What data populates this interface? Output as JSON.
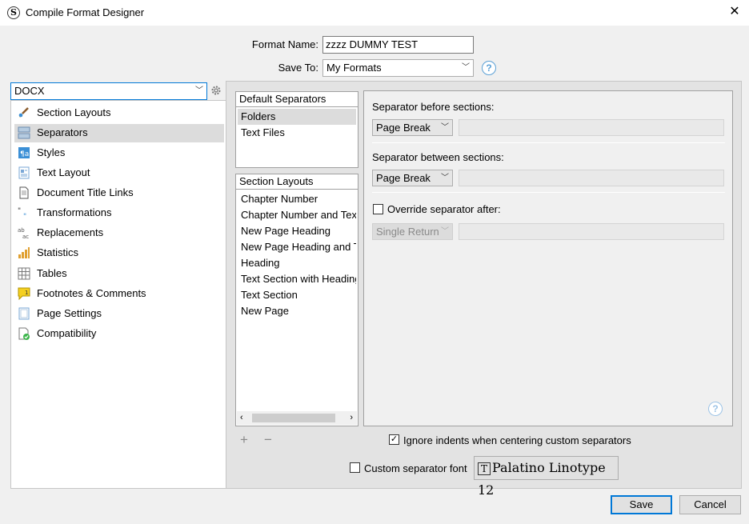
{
  "window": {
    "title": "Compile Format Designer",
    "app_icon": "S",
    "close_glyph": "✕"
  },
  "header": {
    "format_name_label": "Format Name:",
    "format_name_value": "zzzz DUMMY TEST",
    "save_to_label": "Save To:",
    "save_to_value": "My Formats"
  },
  "format_select": {
    "value": "DOCX"
  },
  "sidebar": {
    "items": [
      {
        "label": "Section Layouts",
        "icon": "brush-icon"
      },
      {
        "label": "Separators",
        "icon": "separator-icon"
      },
      {
        "label": "Styles",
        "icon": "styles-icon"
      },
      {
        "label": "Text Layout",
        "icon": "text-layout-icon"
      },
      {
        "label": "Document Title Links",
        "icon": "document-icon"
      },
      {
        "label": "Transformations",
        "icon": "quotes-icon"
      },
      {
        "label": "Replacements",
        "icon": "replace-icon"
      },
      {
        "label": "Statistics",
        "icon": "bar-chart-icon"
      },
      {
        "label": "Tables",
        "icon": "table-icon"
      },
      {
        "label": "Footnotes & Comments",
        "icon": "comment-icon"
      },
      {
        "label": "Page Settings",
        "icon": "page-icon"
      },
      {
        "label": "Compatibility",
        "icon": "compat-icon"
      }
    ],
    "selected_index": 1
  },
  "default_separators": {
    "header": "Default Separators",
    "items": [
      "Folders",
      "Text Files"
    ]
  },
  "section_layouts": {
    "header": "Section Layouts",
    "items": [
      "Chapter Number",
      "Chapter Number and Text",
      "New Page Heading",
      "New Page Heading and Te",
      "Heading",
      "Text Section with Heading",
      "Text Section",
      "New Page"
    ]
  },
  "list_controls": {
    "add": "+",
    "remove": "−"
  },
  "settings": {
    "before_label": "Separator before sections:",
    "before_value": "Page Break",
    "between_label": "Separator between sections:",
    "between_value": "Page Break",
    "override_label": "Override separator after:",
    "override_value": "Single Return"
  },
  "options": {
    "ignore_indents_label": "Ignore indents when centering custom separators",
    "ignore_indents_checked": true,
    "custom_font_label": "Custom separator font",
    "custom_font_checked": false,
    "font_button_label": "Palatino Linotype 12"
  },
  "buttons": {
    "save": "Save",
    "cancel": "Cancel"
  },
  "colors": {
    "accent": "#0078d7",
    "help": "#5aa0d6",
    "selection": "#dcdcdc"
  }
}
